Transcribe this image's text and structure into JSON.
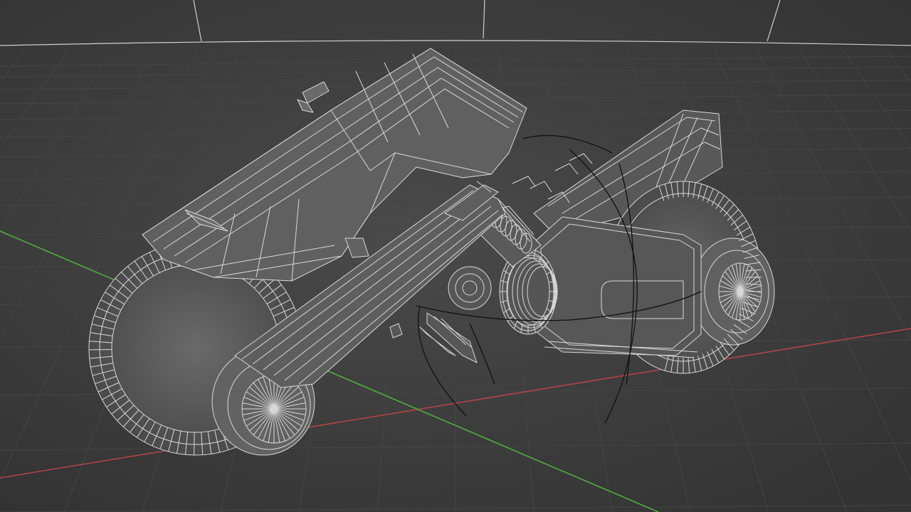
{
  "viewport": {
    "mode": "wireframe",
    "background_color": "#3a3a3a",
    "grid_color": "#454545",
    "x_axis_color": "#b34444",
    "y_axis_color": "#4caf3a",
    "wire_color": "#d8d8d8",
    "annotation_color": "#111111"
  },
  "scene": {
    "model": "wireframe-motorcycle",
    "grid": true,
    "world_axes_visible": [
      "x",
      "y"
    ]
  }
}
